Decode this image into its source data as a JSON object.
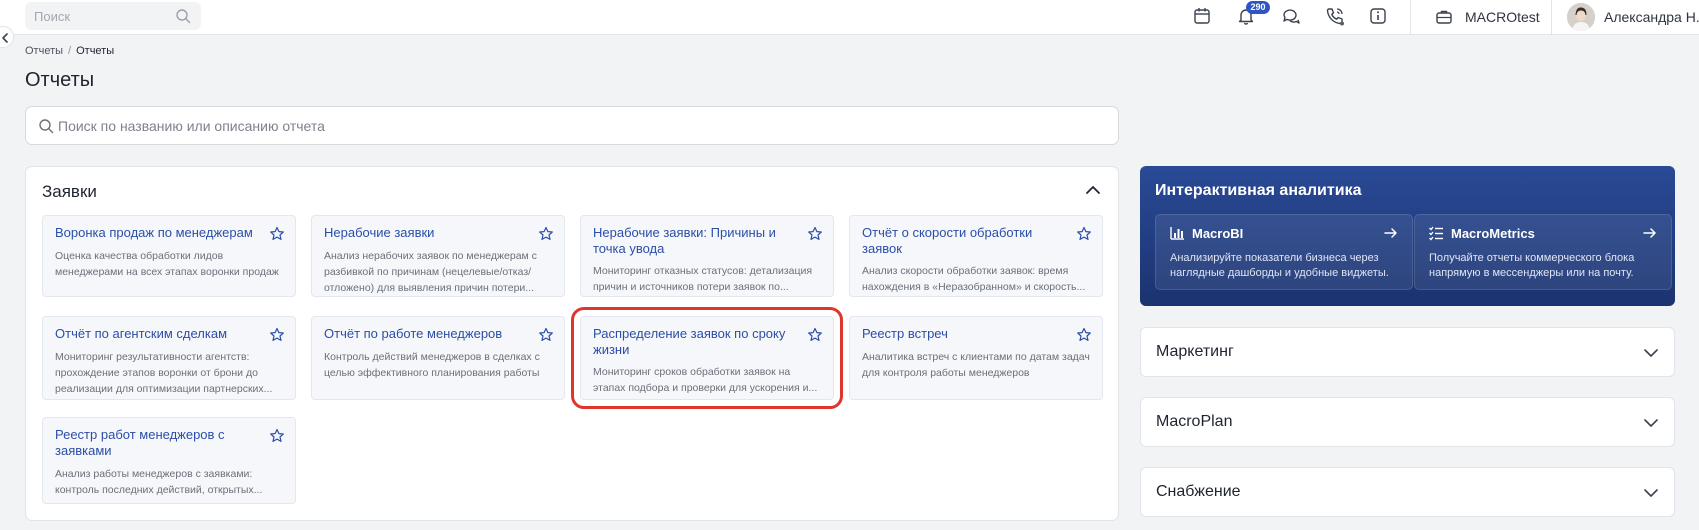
{
  "topbar": {
    "search_placeholder": "Поиск",
    "notification_count": "290",
    "company": "MACROtest",
    "user_name": "Александра Н."
  },
  "breadcrumb": {
    "root": "Отчеты",
    "separator": "/",
    "current": "Отчеты"
  },
  "page_title": "Отчеты",
  "search": {
    "placeholder": "Поиск по названию или описанию отчета"
  },
  "requests_panel": {
    "title": "Заявки",
    "cards": [
      {
        "title": "Воронка продаж по менеджерам",
        "desc": "Оценка качества обработки лидов менеджерами на всех этапах воронки продаж"
      },
      {
        "title": "Нерабочие заявки",
        "desc": "Анализ нерабочих заявок по менеджерам с разбивкой по причинам (нецелевые/отказ/отложено) для выявления причин потери..."
      },
      {
        "title": "Нерабочие заявки: Причины и точка увода",
        "desc": "Мониторинг отказных статусов: детализация причин и источников потери заявок по..."
      },
      {
        "title": "Отчёт о скорости обработки заявок",
        "desc": "Анализ скорости обработки заявок: время нахождения в «Неразобранном» и скорость..."
      },
      {
        "title": "Отчёт по агентским сделкам",
        "desc": "Мониторинг результативности агентств: прохождение этапов воронки от брони до реализации для оптимизации партнерских..."
      },
      {
        "title": "Отчёт по работе менеджеров",
        "desc": "Контроль действий менеджеров в сделках с целью эффективного планирования работы ОП"
      },
      {
        "title": "Распределение заявок по сроку жизни",
        "desc": "Мониторинг сроков обработки заявок на этапах подбора и проверки для ускорения и..."
      },
      {
        "title": "Реестр встреч",
        "desc": "Аналитика встреч с клиентами по датам задач для контроля работы менеджеров"
      },
      {
        "title": "Реестр работ менеджеров с заявками",
        "desc": "Анализ работы менеджеров с заявками: контроль последних действий, открытых..."
      }
    ]
  },
  "analytics": {
    "title": "Интерактивная аналитика",
    "items": [
      {
        "name": "MacroBI",
        "desc": "Анализируйте показатели бизнеса через наглядные дашборды и удобные виджеты."
      },
      {
        "name": "MacroMetrics",
        "desc": "Получайте отчеты коммерческого блока напрямую в мессенджеры или на почту."
      }
    ]
  },
  "sections": [
    {
      "title": "Маркетинг"
    },
    {
      "title": "MacroPlan"
    },
    {
      "title": "Снабжение"
    }
  ],
  "colors": {
    "accent": "#2b4ea8",
    "badge": "#2f55c4",
    "highlight": "#e0352b",
    "analytics_bg": "#213f84"
  }
}
